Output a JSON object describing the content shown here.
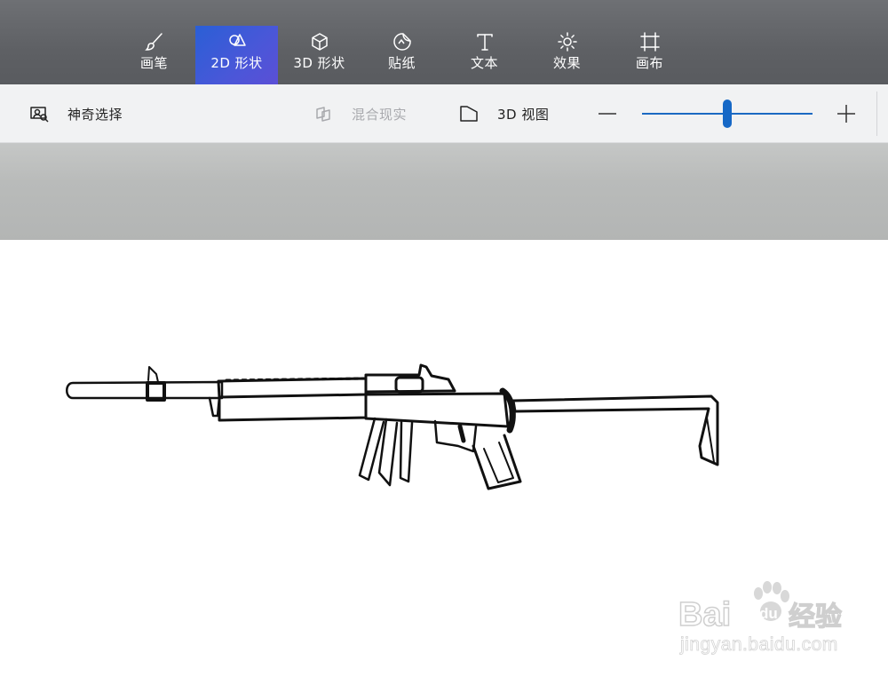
{
  "toolbar": {
    "items": [
      {
        "label": "画笔",
        "icon": "brush-icon"
      },
      {
        "label": "2D 形状",
        "icon": "shapes-2d-icon"
      },
      {
        "label": "3D 形状",
        "icon": "cube-icon"
      },
      {
        "label": "贴纸",
        "icon": "sticker-icon"
      },
      {
        "label": "文本",
        "icon": "text-icon"
      },
      {
        "label": "效果",
        "icon": "effects-sun-icon"
      },
      {
        "label": "画布",
        "icon": "canvas-crop-icon"
      }
    ],
    "active_index": 1,
    "active_color": "#3b5bd8"
  },
  "subbar": {
    "magic_select": "神奇选择",
    "mixed_reality": "混合现实",
    "view_3d": "3D 视图",
    "zoom_level": 0.5,
    "accent": "#1668c6"
  },
  "watermark": {
    "brand": "Bai",
    "brand_du": "du",
    "brand_cn": "经验",
    "url": "jingyan.baidu.com"
  }
}
